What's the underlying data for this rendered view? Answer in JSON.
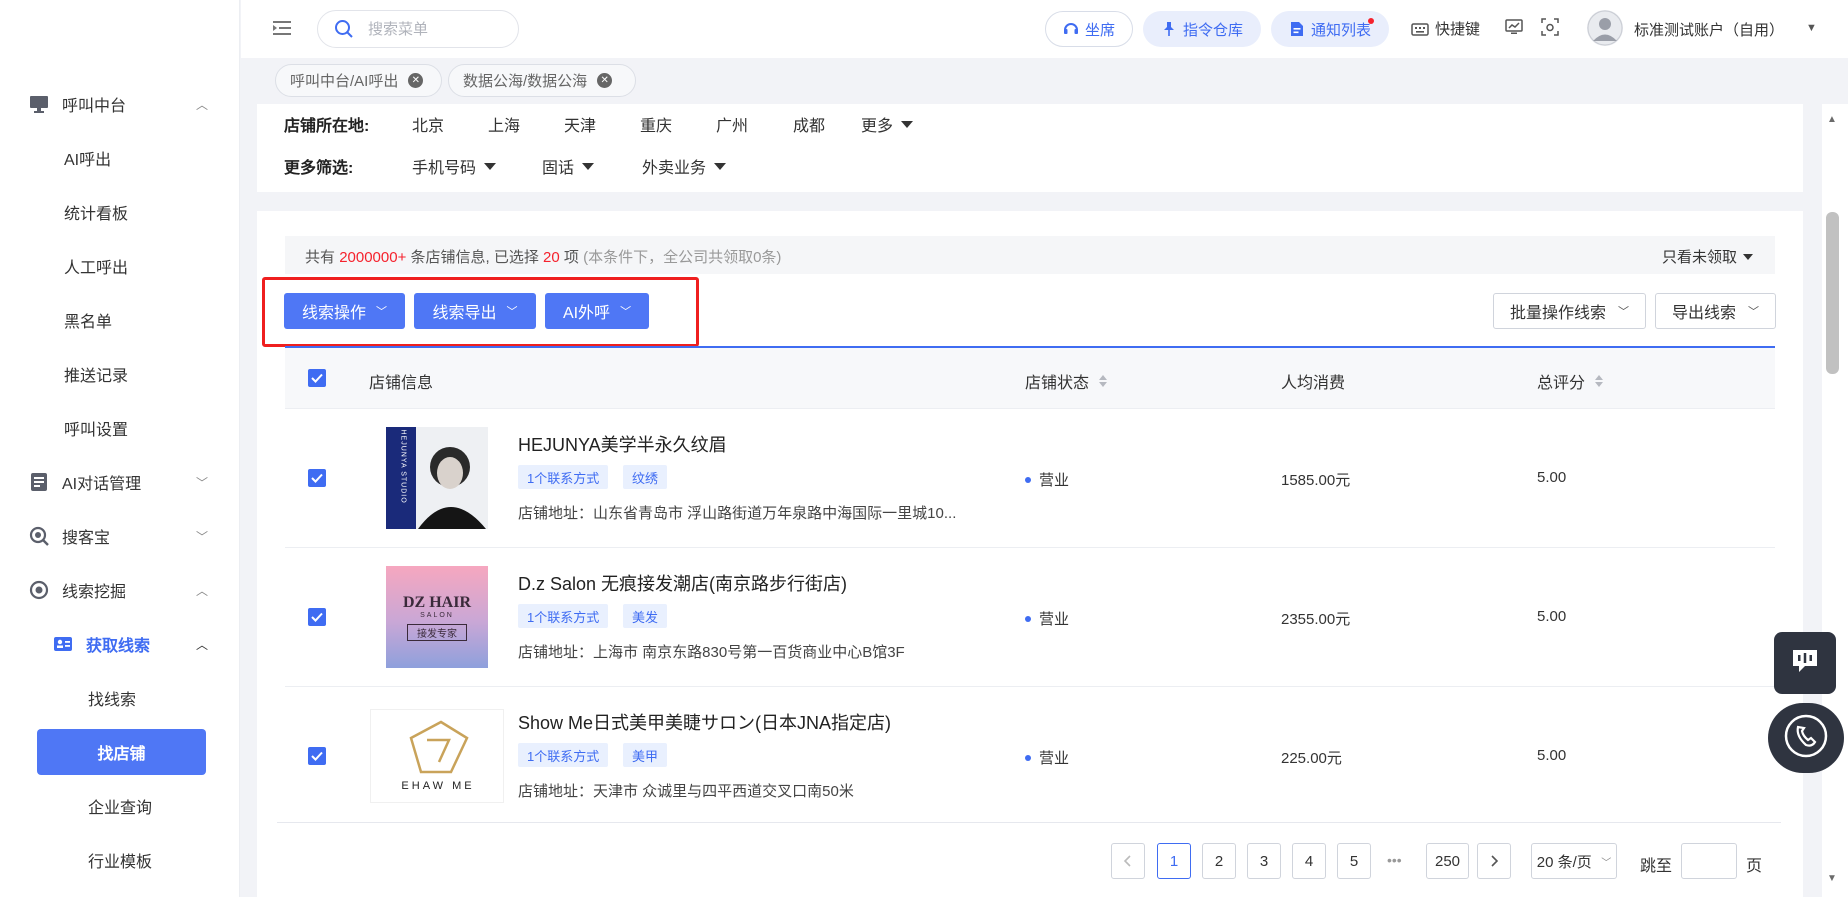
{
  "sidebar": {
    "items": [
      {
        "label": "呼叫中台",
        "icon": "monitor-icon"
      },
      {
        "label": "AI呼出"
      },
      {
        "label": "统计看板"
      },
      {
        "label": "人工呼出"
      },
      {
        "label": "黑名单"
      },
      {
        "label": "推送记录"
      },
      {
        "label": "呼叫设置"
      },
      {
        "label": "AI对话管理",
        "icon": "document-icon"
      },
      {
        "label": "搜客宝",
        "icon": "search-treasure-icon"
      },
      {
        "label": "线索挖掘",
        "icon": "mining-icon"
      },
      {
        "label": "获取线索",
        "icon": "id-card-icon"
      },
      {
        "label": "找线索"
      },
      {
        "label": "找店铺"
      },
      {
        "label": "企业查询"
      },
      {
        "label": "行业模板"
      }
    ]
  },
  "header": {
    "search_placeholder": "搜索菜单",
    "agent_label": "坐席",
    "command_label": "指令仓库",
    "notify_label": "通知列表",
    "shortcut_label": "快捷键",
    "user_name": "标准测试账户（自用）"
  },
  "tabs": [
    {
      "label": "呼叫中台/AI呼出"
    },
    {
      "label": "数据公海/数据公海"
    }
  ],
  "filters": {
    "location_label": "店铺所在地:",
    "cities": [
      "北京",
      "上海",
      "天津",
      "重庆",
      "广州",
      "成都"
    ],
    "more_label": "更多",
    "more_filters_label": "更多筛选:",
    "dropdowns": [
      "手机号码",
      "固话",
      "外卖业务"
    ]
  },
  "summary": {
    "prefix": "共有",
    "total": "2000000+",
    "mid": "条店铺信息, 已选择",
    "selected": "20",
    "suffix": "项",
    "note": "(本条件下，全公司共领取0条)",
    "only_unclaimed": "只看未领取"
  },
  "toolbar": {
    "lead_ops": "线索操作",
    "lead_export": "线索导出",
    "ai_call": "AI外呼",
    "batch_ops": "批量操作线索",
    "export_leads": "导出线索"
  },
  "table": {
    "columns": [
      "店铺信息",
      "店铺状态",
      "人均消费",
      "总评分"
    ],
    "rows": [
      {
        "name": "HEJUNYA美学半永久纹眉",
        "tags": [
          "1个联系方式",
          "纹绣"
        ],
        "address": "店铺地址：山东省青岛市 浮山路街道万年泉路中海国际一里城10...",
        "status": "营业",
        "price": "1585.00元",
        "score": "5.00",
        "thumb_text": "HEJUNYA STUDIO"
      },
      {
        "name": "D.z Salon 无痕接发潮店(南京路步行街店)",
        "tags": [
          "1个联系方式",
          "美发"
        ],
        "address": "店铺地址：上海市 南京东路830号第一百货商业中心B馆3F",
        "status": "营业",
        "price": "2355.00元",
        "score": "5.00",
        "thumb_text": "DZ HAIR",
        "thumb_sub": "SALON",
        "thumb_sub2": "接发专家"
      },
      {
        "name": "Show Me日式美甲美睫サロン(日本JNA指定店)",
        "tags": [
          "1个联系方式",
          "美甲"
        ],
        "address": "店铺地址：天津市 众诚里与四平西道交叉口南50米",
        "status": "营业",
        "price": "225.00元",
        "score": "5.00",
        "thumb_text": "EHAW ME"
      }
    ]
  },
  "pagination": {
    "pages": [
      "1",
      "2",
      "3",
      "4",
      "5"
    ],
    "ellipsis": "•••",
    "last": "250",
    "page_size": "20 条/页",
    "jump_label": "跳至",
    "page_unit": "页",
    "current": 1
  },
  "colors": {
    "primary": "#4f77f5",
    "accent_red": "#f5222d",
    "highlight_border": "#ef1f1f"
  }
}
